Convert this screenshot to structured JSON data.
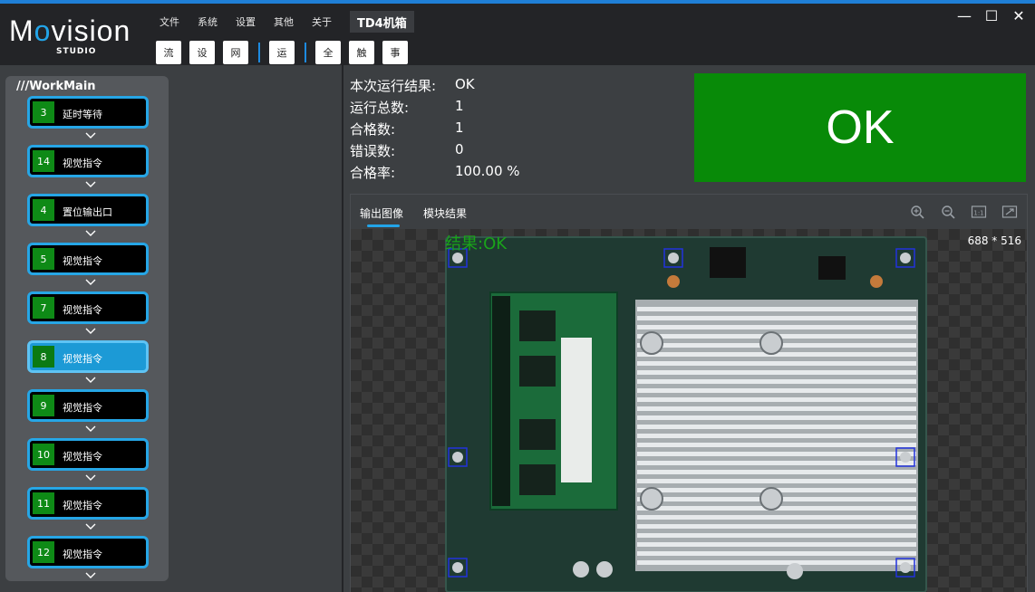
{
  "app": {
    "logo": {
      "brand_prefix": "M",
      "brand_o": "o",
      "brand_suffix": "vision",
      "sub": "STUDIO"
    },
    "menu": [
      "文件",
      "系统",
      "设置",
      "其他",
      "关于"
    ],
    "project_title": "TD4机箱",
    "toolbar": {
      "group1": [
        "流",
        "设",
        "网"
      ],
      "group2": [
        "运"
      ],
      "group3": [
        "全",
        "触",
        "事"
      ]
    },
    "window": {
      "minimize": "—",
      "maximize": "☐",
      "close": "✕"
    }
  },
  "flow": {
    "title": "///WorkMain",
    "steps": [
      {
        "num": "3",
        "label": "延时等待"
      },
      {
        "num": "14",
        "label": "视觉指令"
      },
      {
        "num": "4",
        "label": "置位输出口"
      },
      {
        "num": "5",
        "label": "视觉指令"
      },
      {
        "num": "7",
        "label": "视觉指令"
      },
      {
        "num": "8",
        "label": "视觉指令",
        "active": true
      },
      {
        "num": "9",
        "label": "视觉指令"
      },
      {
        "num": "10",
        "label": "视觉指令"
      },
      {
        "num": "11",
        "label": "视觉指令"
      },
      {
        "num": "12",
        "label": "视觉指令"
      }
    ]
  },
  "stats": [
    {
      "label": "本次运行结果:",
      "value": "OK"
    },
    {
      "label": "运行总数:",
      "value": "1"
    },
    {
      "label": "合格数:",
      "value": "1"
    },
    {
      "label": "错误数:",
      "value": "0"
    },
    {
      "label": "合格率:",
      "value": "100.00 %"
    }
  ],
  "result_badge": {
    "text": "OK",
    "color": "#088a08"
  },
  "viewer": {
    "tabs": [
      "输出图像",
      "模块结果"
    ],
    "active_tab": 0,
    "tools": [
      "zoom-in-icon",
      "zoom-out-icon",
      "actual-size-icon",
      "fit-icon"
    ],
    "tool_1_1": "1:1",
    "overlay_result": "结果:OK",
    "image_size": "688 * 516"
  }
}
